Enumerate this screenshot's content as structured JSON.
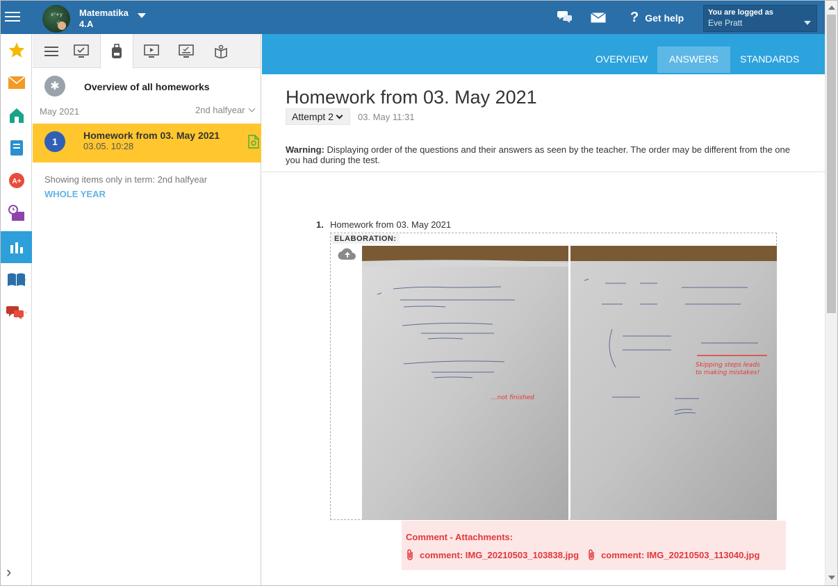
{
  "topbar": {
    "class_name": "Matematika",
    "class_group": "4.A",
    "help_label": "Get help",
    "user_logged_label": "You are logged as",
    "user_name": "Eve Pratt"
  },
  "rail": {
    "icons": [
      "star-icon",
      "mail-icon",
      "home-icon",
      "notebook-icon",
      "grade-icon",
      "schedule-icon",
      "stats-icon",
      "book-icon",
      "chat-icon"
    ],
    "active_index": 6
  },
  "panel": {
    "overview_label": "Overview of all homeworks",
    "month": "May 2021",
    "term": "2nd halfyear",
    "item": {
      "number": "1",
      "title": "Homework from 03. May 2021",
      "datetime": "03.05. 10:28"
    },
    "term_note": "Showing items only in term: 2nd halfyear",
    "whole_year_label": "WHOLE YEAR"
  },
  "main": {
    "tabs": [
      {
        "label": "OVERVIEW"
      },
      {
        "label": "ANSWERS"
      },
      {
        "label": "STANDARDS"
      }
    ],
    "active_tab": "ANSWERS",
    "heading": "Homework from 03. May 2021",
    "attempt": "Attempt 2",
    "attempt_time": "03. May 11:31",
    "warning_label": "Warning:",
    "warning_text": "Displaying order of the questions and their answers as seen by the teacher. The order may be different from the one you had during the test.",
    "question": {
      "number": "1.",
      "title": "Homework from 03. May 2021",
      "elaboration_label": "ELABORATION:",
      "photo_notes": {
        "left": "...not finished",
        "right_line1": "Skipping steps leads",
        "right_line2": "to making mistakes!"
      }
    },
    "comment": {
      "title": "Comment - Attachments:",
      "files": [
        {
          "label": "comment: IMG_20210503_103838.jpg"
        },
        {
          "label": "comment: IMG_20210503_113040.jpg"
        }
      ]
    }
  },
  "colors": {
    "topbar": "#2a6fa8",
    "tabbar": "#2ca3dd",
    "highlight": "#ffc62e",
    "comment_text": "#e0393a",
    "comment_bg": "#fde6e6"
  }
}
